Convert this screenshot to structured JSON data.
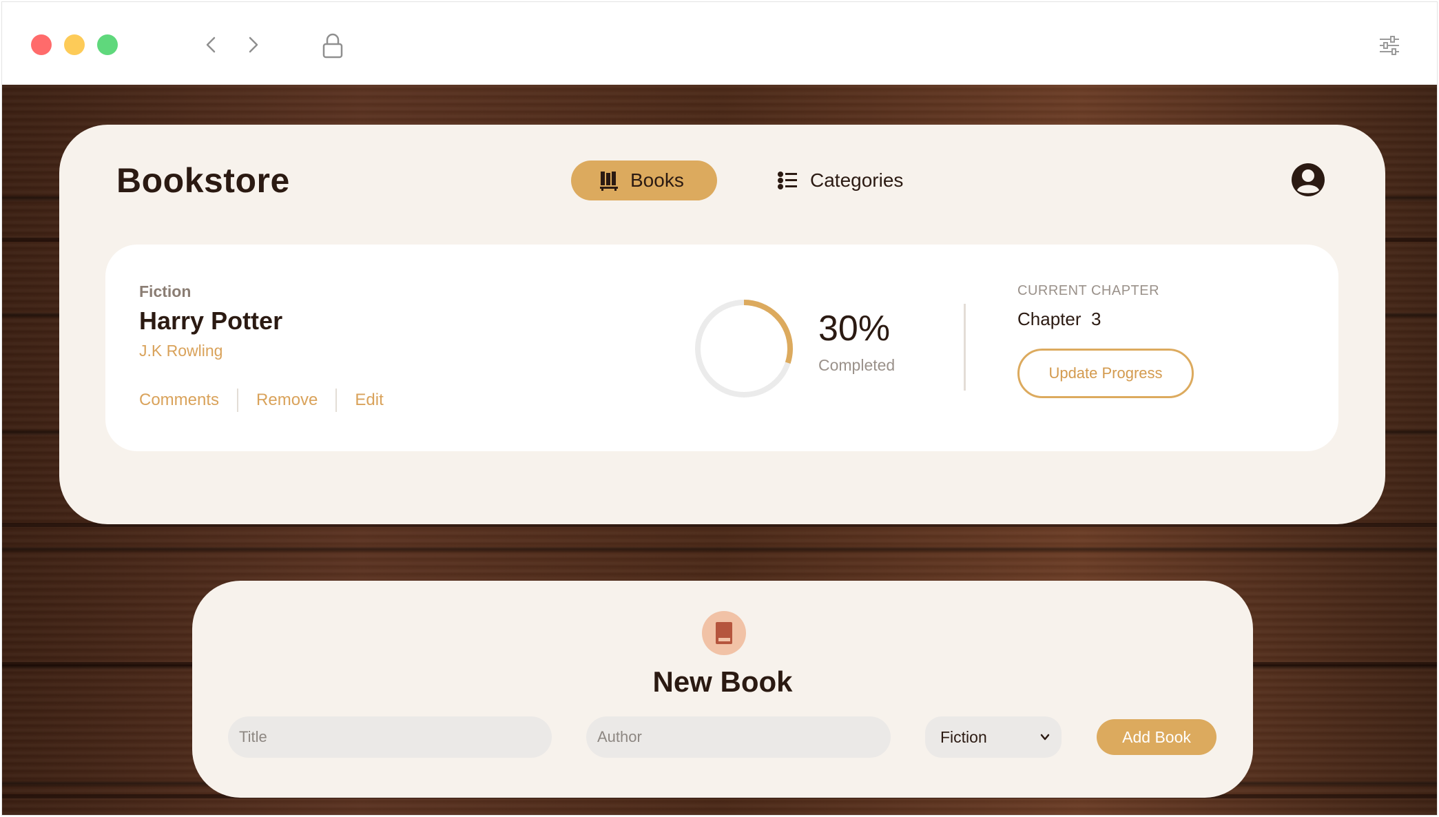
{
  "colors": {
    "accent": "#dcaa5e",
    "text_dark": "#2b1a12",
    "card_bg": "#f7f2ec",
    "traffic_red": "#ff6b6b",
    "traffic_yellow": "#fdcb58",
    "traffic_green": "#5fd87c"
  },
  "browser": {
    "icons": [
      "back-arrow-icon",
      "forward-arrow-icon",
      "lock-icon",
      "settings-sliders-icon"
    ]
  },
  "header": {
    "brand": "Bookstore",
    "tabs": [
      {
        "label": "Books",
        "icon": "bookshelf-icon",
        "active": true
      },
      {
        "label": "Categories",
        "icon": "list-icon",
        "active": false
      }
    ],
    "profile_icon": "user-circle-icon"
  },
  "book": {
    "category": "Fiction",
    "title": "Harry Potter",
    "author": "J.K Rowling",
    "actions": {
      "comments": "Comments",
      "remove": "Remove",
      "edit": "Edit"
    },
    "progress": {
      "percent": 30,
      "percent_label": "30%",
      "completed_label": "Completed"
    },
    "chapter": {
      "label": "CURRENT CHAPTER",
      "value": "Chapter  3"
    },
    "update_button": "Update Progress"
  },
  "new_book": {
    "icon": "book-icon",
    "title": "New Book",
    "title_placeholder": "Title",
    "author_placeholder": "Author",
    "category_selected": "Fiction",
    "add_button": "Add Book"
  }
}
